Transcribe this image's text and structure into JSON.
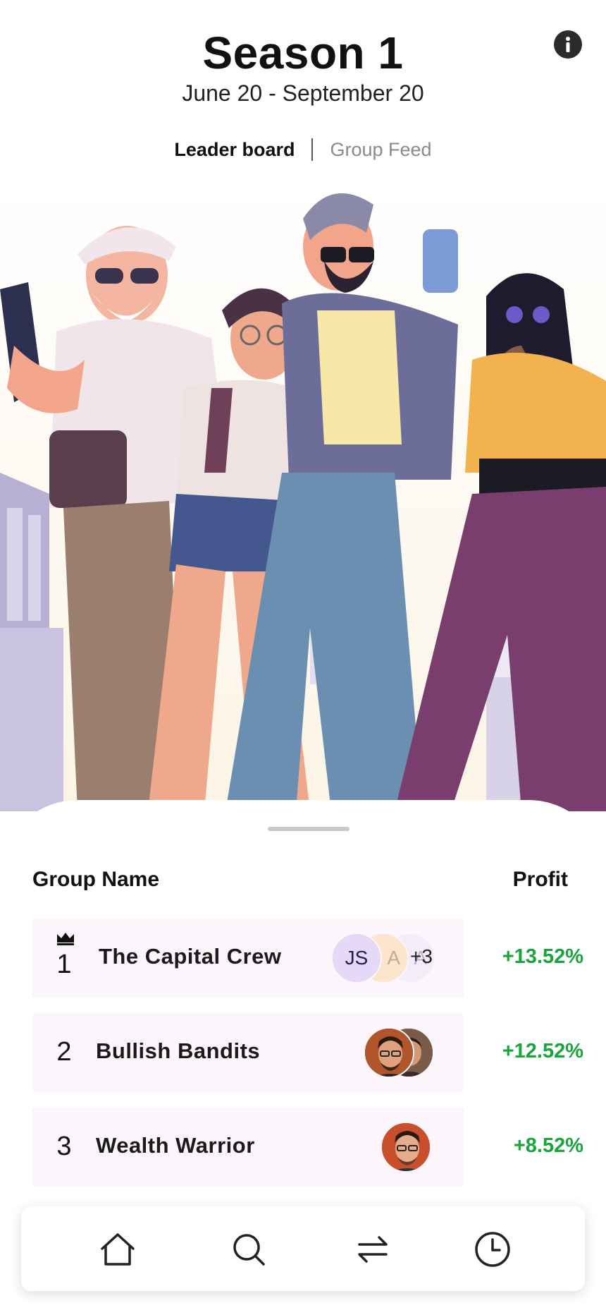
{
  "header": {
    "title": "Season 1",
    "subtitle": "June 20 - September 20",
    "info_icon": "info-icon"
  },
  "tabs": [
    {
      "label": "Leader board",
      "active": true
    },
    {
      "label": "Group Feed",
      "active": false
    }
  ],
  "leaderboard": {
    "col_group": "Group Name",
    "col_profit": "Profit",
    "rows": [
      {
        "rank": "1",
        "crown": true,
        "name": "The Capital Crew",
        "avatar_initials": "JS",
        "avatar2_text": "A",
        "avatar3_text": "A",
        "more": "+3",
        "profit": "+13.52%"
      },
      {
        "rank": "2",
        "name": "Bullish Bandits",
        "profit": "+12.52%"
      },
      {
        "rank": "3",
        "name": "Wealth Warrior",
        "profit": "+8.52%"
      }
    ]
  },
  "nav": [
    {
      "icon": "home-icon"
    },
    {
      "icon": "search-icon"
    },
    {
      "icon": "swap-icon"
    },
    {
      "icon": "history-icon"
    }
  ],
  "colors": {
    "profit": "#17a53c",
    "row_bg": "#fcf6fc",
    "accent_purple": "#e6d9f7"
  }
}
